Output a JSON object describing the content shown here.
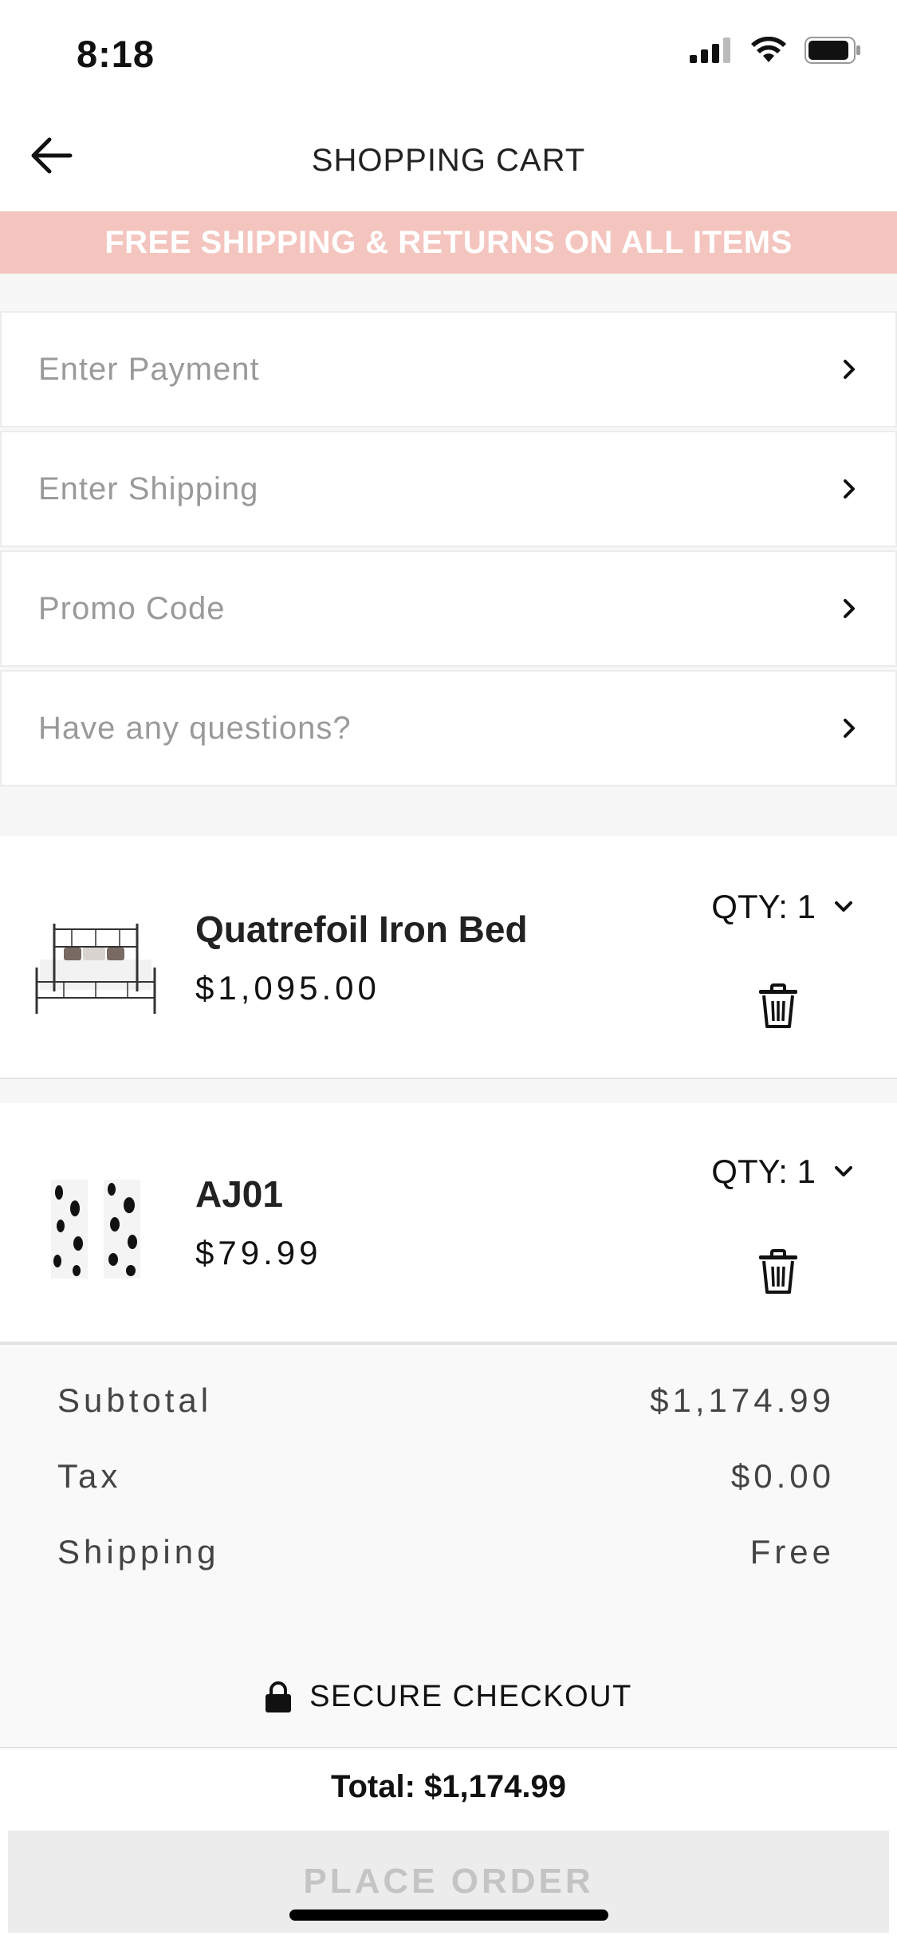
{
  "status_bar": {
    "time": "8:18"
  },
  "nav": {
    "title": "SHOPPING CART"
  },
  "banner": {
    "text": "FREE SHIPPING & RETURNS ON ALL ITEMS"
  },
  "options": [
    {
      "label": "Enter Payment"
    },
    {
      "label": "Enter Shipping"
    },
    {
      "label": "Promo Code"
    },
    {
      "label": "Have any questions?"
    }
  ],
  "items": [
    {
      "name": "Quatrefoil Iron Bed",
      "price": "$1,095.00",
      "qty": "QTY: 1",
      "thumb": "iron-bed-thumbnail"
    },
    {
      "name": "AJ01",
      "price": "$79.99",
      "qty": "QTY: 1",
      "thumb": "spotted-curtain-thumbnail"
    }
  ],
  "summary": {
    "subtotal_label": "Subtotal",
    "subtotal_value": "$1,174.99",
    "tax_label": "Tax",
    "tax_value": "$0.00",
    "shipping_label": "Shipping",
    "shipping_value": "Free"
  },
  "secure_checkout": "SECURE CHECKOUT",
  "total": "Total: $1,174.99",
  "place_order": "PLACE ORDER",
  "colors": {
    "banner": "#f4c5bf",
    "disabled_button": "#ececec",
    "disabled_text": "#c4c4c4"
  }
}
